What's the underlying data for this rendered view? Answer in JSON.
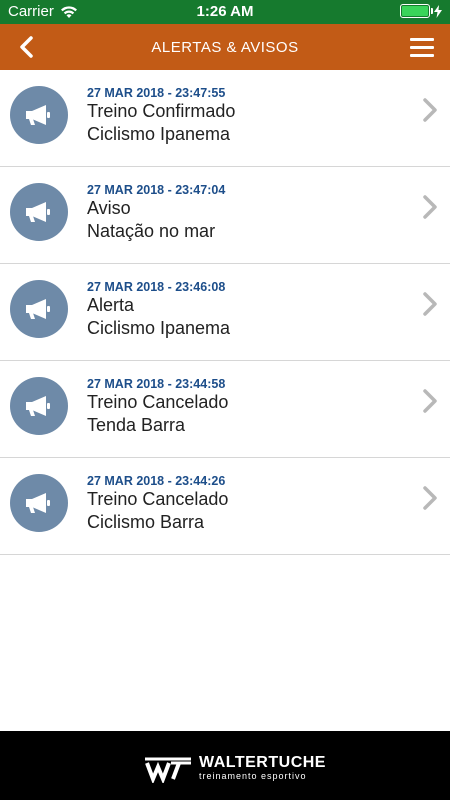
{
  "status_bar": {
    "carrier": "Carrier",
    "time": "1:26 AM",
    "battery_level": 1.0,
    "battery_color": "#3ad45a"
  },
  "nav": {
    "title": "ALERTAS & AVISOS",
    "back_icon": "chevron-left-icon",
    "menu_icon": "hamburger-menu-icon",
    "color": "#c25b16"
  },
  "alerts": [
    {
      "date": "27 MAR 2018 - 23:47:55",
      "title": "Treino Confirmado",
      "subtitle": "Ciclismo Ipanema"
    },
    {
      "date": "27 MAR 2018 - 23:47:04",
      "title": "Aviso",
      "subtitle": "Natação no mar"
    },
    {
      "date": "27 MAR 2018 - 23:46:08",
      "title": "Alerta",
      "subtitle": "Ciclismo Ipanema"
    },
    {
      "date": "27 MAR 2018 - 23:44:58",
      "title": "Treino Cancelado",
      "subtitle": "Tenda Barra"
    },
    {
      "date": "27 MAR 2018 - 23:44:26",
      "title": "Treino Cancelado",
      "subtitle": "Ciclismo Barra"
    }
  ],
  "footer": {
    "brand": "WALTERTUCHE",
    "tagline": "treinamento esportivo"
  }
}
